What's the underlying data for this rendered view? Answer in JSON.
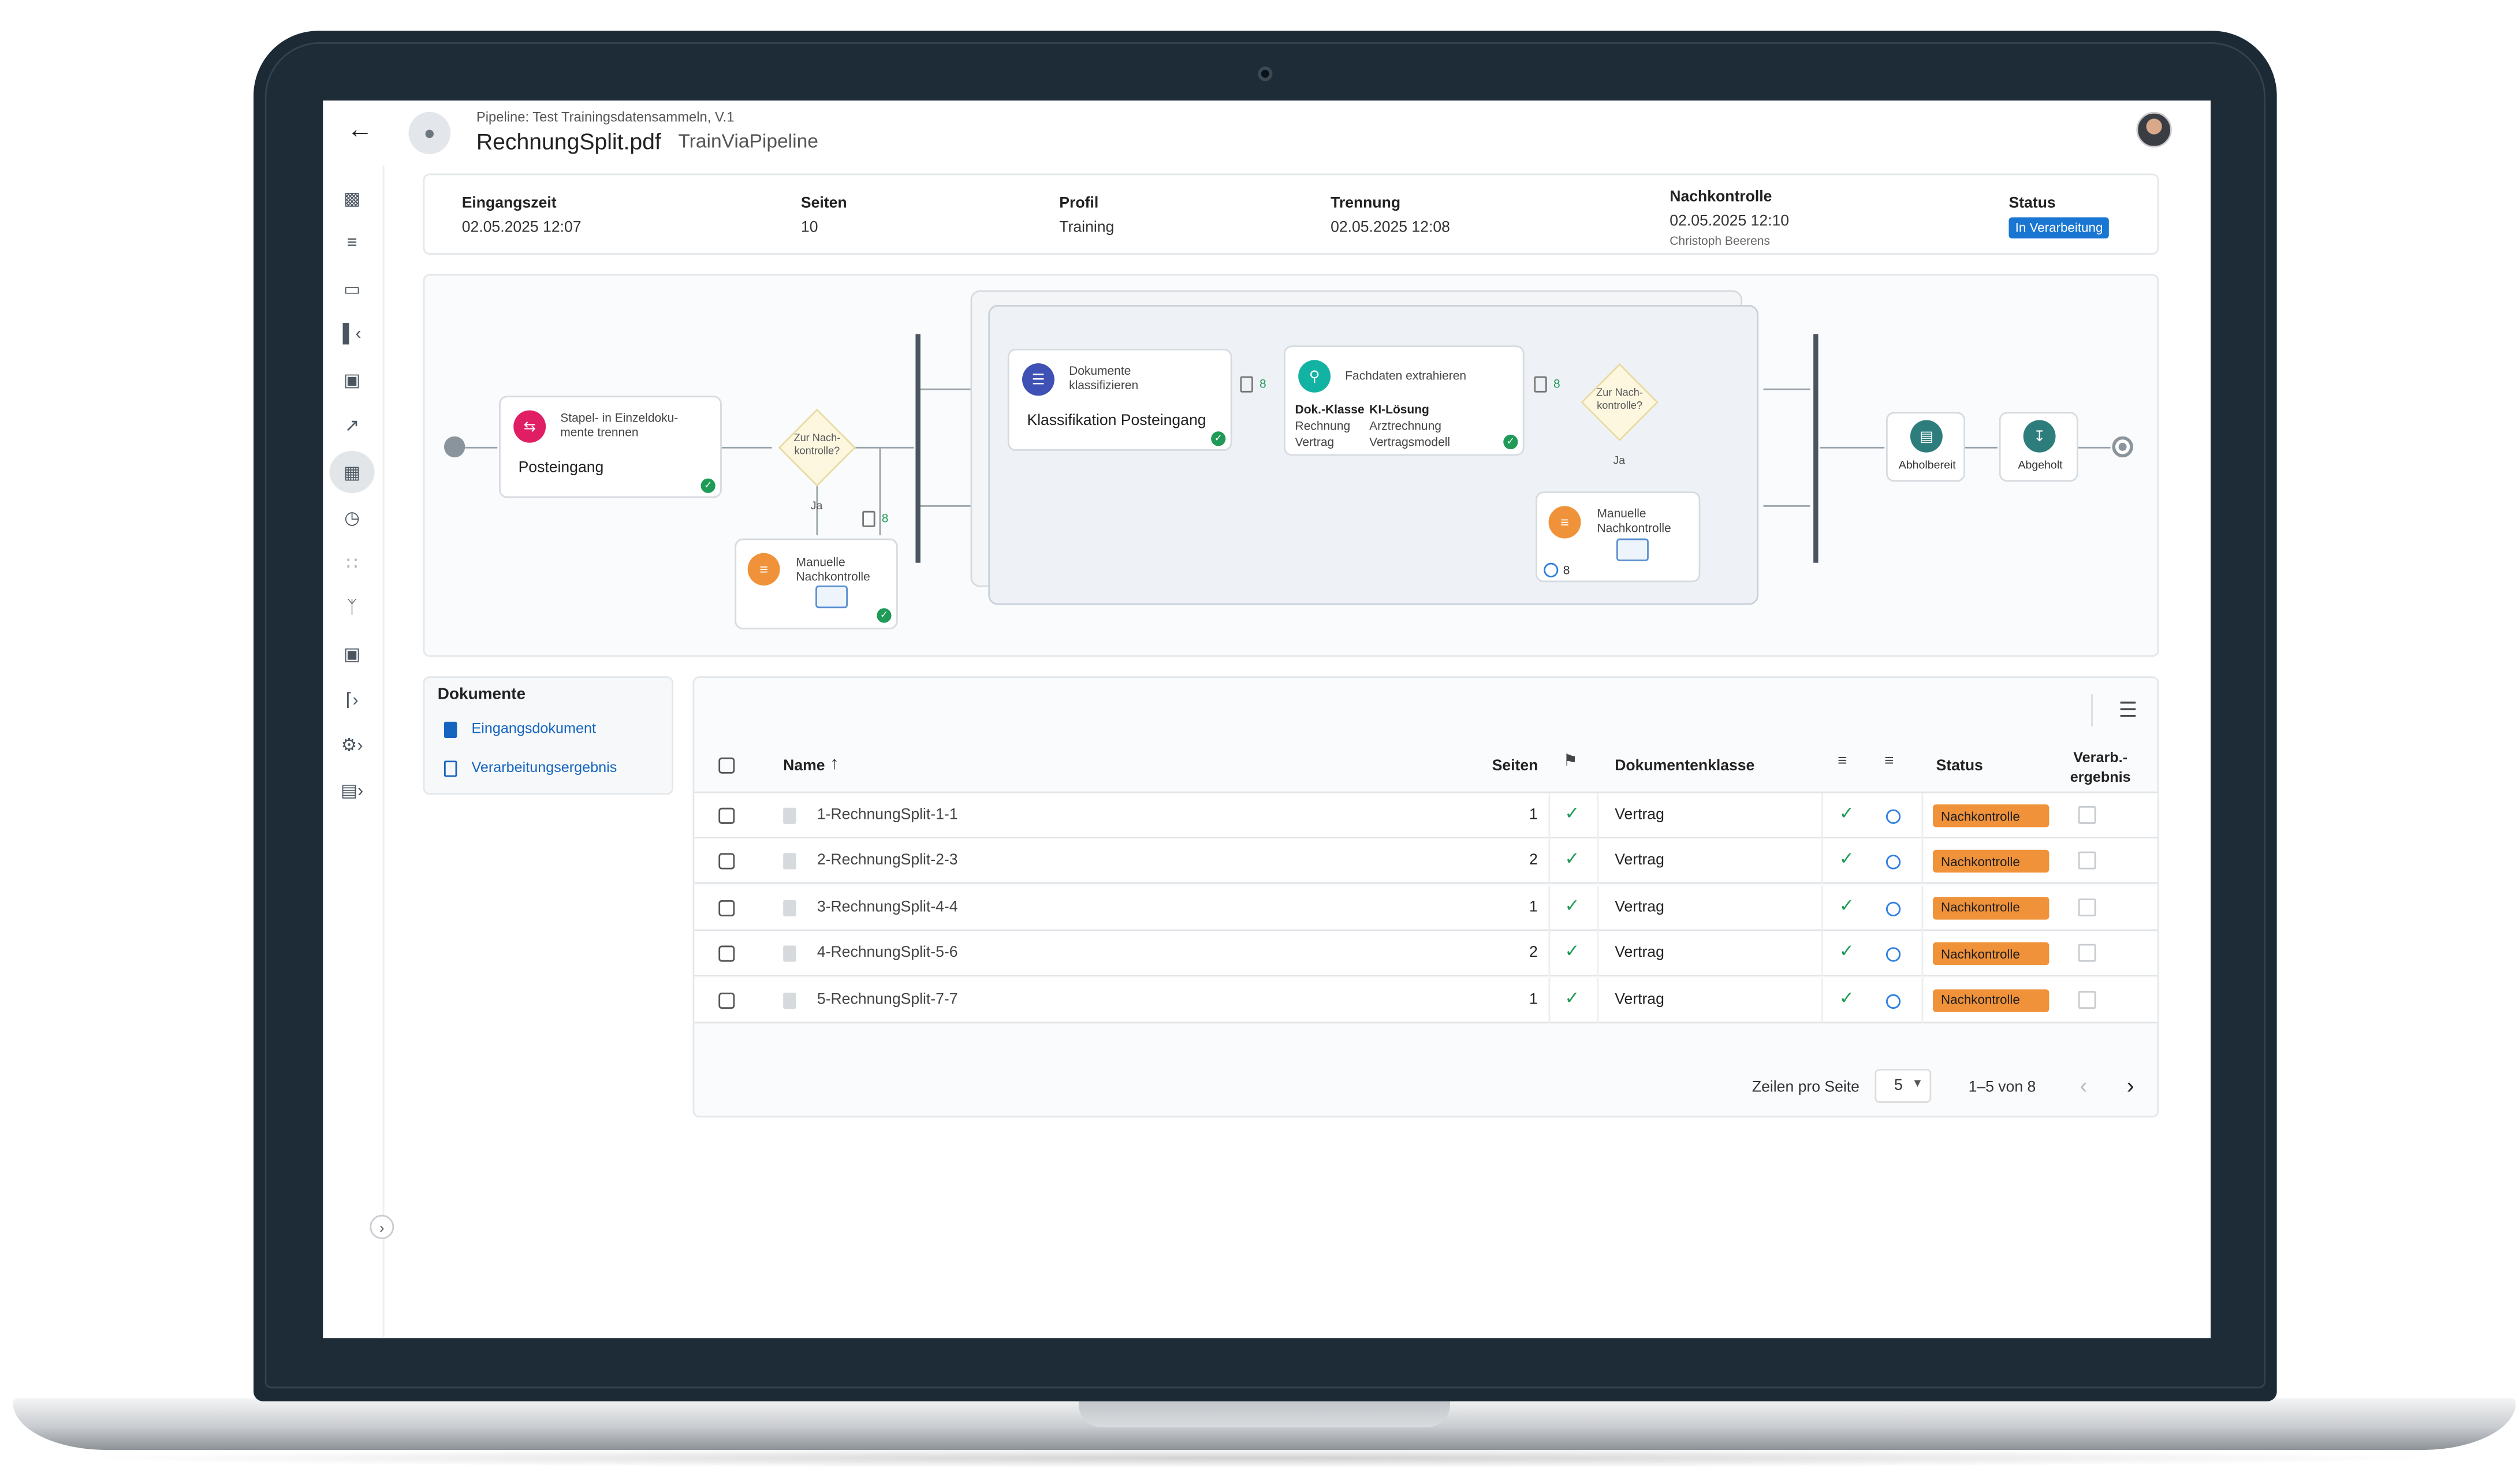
{
  "header": {
    "pipeline_label": "Pipeline: Test Trainingsdatensammeln, V.1",
    "file_name": "RechnungSplit.pdf",
    "profile_name": "TrainViaPipeline"
  },
  "info": {
    "eingangszeit_label": "Eingangszeit",
    "eingangszeit_value": "02.05.2025 12:07",
    "seiten_label": "Seiten",
    "seiten_value": "10",
    "profil_label": "Profil",
    "profil_value": "Training",
    "trennung_label": "Trennung",
    "trennung_value": "02.05.2025 12:08",
    "nachkontrolle_label": "Nachkontrolle",
    "nachkontrolle_value": "02.05.2025 12:10",
    "nachkontrolle_user": "Christoph Beerens",
    "status_label": "Status",
    "status_value": "In Verarbeitung"
  },
  "flow": {
    "split_title": "Stapel- in Einzeldoku-\nmente trennen",
    "split_name": "Posteingang",
    "decision1": "Zur Nach-\nkontrolle?",
    "ja1": "Ja",
    "manual1": "Manuelle\nNachkontrolle",
    "count1": "8",
    "classify_title": "Dokumente\nklassifizieren",
    "classify_name": "Klassifikation Posteingang",
    "count2": "8",
    "extract_title": "Fachdaten extrahieren",
    "extract_col1_head": "Dok.-Klasse",
    "extract_col2_head": "KI-Lösung",
    "extract_row1_col1": "Rechnung",
    "extract_row1_col2": "Arztrechnung",
    "extract_row2_col1": "Vertrag",
    "extract_row2_col2": "Vertragsmodell",
    "count3": "8",
    "decision2": "Zur Nach-\nkontrolle?",
    "ja2": "Ja",
    "manual2": "Manuelle\nNachkontrolle",
    "count4": "8",
    "abholbereit": "Abholbereit",
    "abgeholt": "Abgeholt"
  },
  "documents": {
    "title": "Dokumente",
    "link1": "Eingangsdokument",
    "link2": "Verarbeitungsergebnis"
  },
  "table": {
    "col_name": "Name",
    "col_seiten": "Seiten",
    "col_klasse": "Dokumentenklasse",
    "col_status": "Status",
    "col_ergebnis": "Verarb.-\nergebnis",
    "rows": [
      {
        "name": "1-RechnungSplit-1-1",
        "seiten": "1",
        "klasse": "Vertrag",
        "status": "Nachkontrolle"
      },
      {
        "name": "2-RechnungSplit-2-3",
        "seiten": "2",
        "klasse": "Vertrag",
        "status": "Nachkontrolle"
      },
      {
        "name": "3-RechnungSplit-4-4",
        "seiten": "1",
        "klasse": "Vertrag",
        "status": "Nachkontrolle"
      },
      {
        "name": "4-RechnungSplit-5-6",
        "seiten": "2",
        "klasse": "Vertrag",
        "status": "Nachkontrolle"
      },
      {
        "name": "5-RechnungSplit-7-7",
        "seiten": "1",
        "klasse": "Vertrag",
        "status": "Nachkontrolle"
      }
    ],
    "rows_per_page_label": "Zeilen pro Seite",
    "rows_per_page_value": "5",
    "range": "1–5 von 8"
  },
  "colors": {
    "accent": "#1565c0",
    "status_badge": "#1976d2",
    "nachkontrolle": "#f0923a",
    "success": "#1f9a57"
  }
}
